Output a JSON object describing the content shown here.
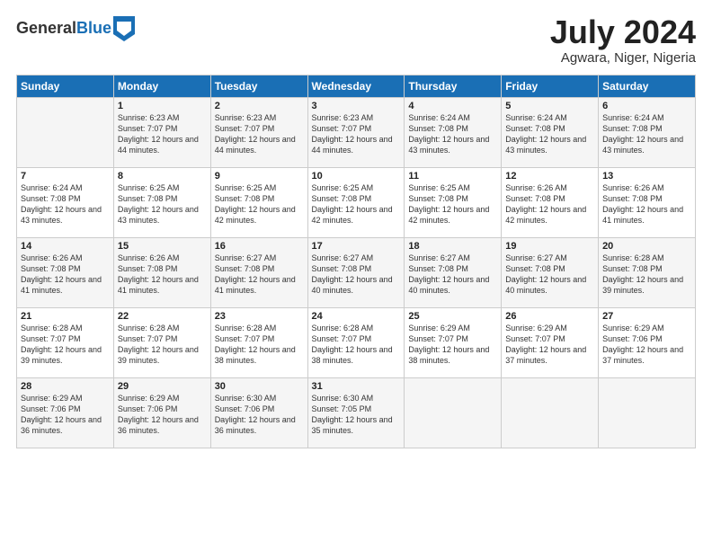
{
  "logo": {
    "general": "General",
    "blue": "Blue"
  },
  "header": {
    "month": "July 2024",
    "location": "Agwara, Niger, Nigeria"
  },
  "weekdays": [
    "Sunday",
    "Monday",
    "Tuesday",
    "Wednesday",
    "Thursday",
    "Friday",
    "Saturday"
  ],
  "weeks": [
    [
      {
        "day": "",
        "sunrise": "",
        "sunset": "",
        "daylight": ""
      },
      {
        "day": "1",
        "sunrise": "Sunrise: 6:23 AM",
        "sunset": "Sunset: 7:07 PM",
        "daylight": "Daylight: 12 hours and 44 minutes."
      },
      {
        "day": "2",
        "sunrise": "Sunrise: 6:23 AM",
        "sunset": "Sunset: 7:07 PM",
        "daylight": "Daylight: 12 hours and 44 minutes."
      },
      {
        "day": "3",
        "sunrise": "Sunrise: 6:23 AM",
        "sunset": "Sunset: 7:07 PM",
        "daylight": "Daylight: 12 hours and 44 minutes."
      },
      {
        "day": "4",
        "sunrise": "Sunrise: 6:24 AM",
        "sunset": "Sunset: 7:08 PM",
        "daylight": "Daylight: 12 hours and 43 minutes."
      },
      {
        "day": "5",
        "sunrise": "Sunrise: 6:24 AM",
        "sunset": "Sunset: 7:08 PM",
        "daylight": "Daylight: 12 hours and 43 minutes."
      },
      {
        "day": "6",
        "sunrise": "Sunrise: 6:24 AM",
        "sunset": "Sunset: 7:08 PM",
        "daylight": "Daylight: 12 hours and 43 minutes."
      }
    ],
    [
      {
        "day": "7",
        "sunrise": "Sunrise: 6:24 AM",
        "sunset": "Sunset: 7:08 PM",
        "daylight": "Daylight: 12 hours and 43 minutes."
      },
      {
        "day": "8",
        "sunrise": "Sunrise: 6:25 AM",
        "sunset": "Sunset: 7:08 PM",
        "daylight": "Daylight: 12 hours and 43 minutes."
      },
      {
        "day": "9",
        "sunrise": "Sunrise: 6:25 AM",
        "sunset": "Sunset: 7:08 PM",
        "daylight": "Daylight: 12 hours and 42 minutes."
      },
      {
        "day": "10",
        "sunrise": "Sunrise: 6:25 AM",
        "sunset": "Sunset: 7:08 PM",
        "daylight": "Daylight: 12 hours and 42 minutes."
      },
      {
        "day": "11",
        "sunrise": "Sunrise: 6:25 AM",
        "sunset": "Sunset: 7:08 PM",
        "daylight": "Daylight: 12 hours and 42 minutes."
      },
      {
        "day": "12",
        "sunrise": "Sunrise: 6:26 AM",
        "sunset": "Sunset: 7:08 PM",
        "daylight": "Daylight: 12 hours and 42 minutes."
      },
      {
        "day": "13",
        "sunrise": "Sunrise: 6:26 AM",
        "sunset": "Sunset: 7:08 PM",
        "daylight": "Daylight: 12 hours and 41 minutes."
      }
    ],
    [
      {
        "day": "14",
        "sunrise": "Sunrise: 6:26 AM",
        "sunset": "Sunset: 7:08 PM",
        "daylight": "Daylight: 12 hours and 41 minutes."
      },
      {
        "day": "15",
        "sunrise": "Sunrise: 6:26 AM",
        "sunset": "Sunset: 7:08 PM",
        "daylight": "Daylight: 12 hours and 41 minutes."
      },
      {
        "day": "16",
        "sunrise": "Sunrise: 6:27 AM",
        "sunset": "Sunset: 7:08 PM",
        "daylight": "Daylight: 12 hours and 41 minutes."
      },
      {
        "day": "17",
        "sunrise": "Sunrise: 6:27 AM",
        "sunset": "Sunset: 7:08 PM",
        "daylight": "Daylight: 12 hours and 40 minutes."
      },
      {
        "day": "18",
        "sunrise": "Sunrise: 6:27 AM",
        "sunset": "Sunset: 7:08 PM",
        "daylight": "Daylight: 12 hours and 40 minutes."
      },
      {
        "day": "19",
        "sunrise": "Sunrise: 6:27 AM",
        "sunset": "Sunset: 7:08 PM",
        "daylight": "Daylight: 12 hours and 40 minutes."
      },
      {
        "day": "20",
        "sunrise": "Sunrise: 6:28 AM",
        "sunset": "Sunset: 7:08 PM",
        "daylight": "Daylight: 12 hours and 39 minutes."
      }
    ],
    [
      {
        "day": "21",
        "sunrise": "Sunrise: 6:28 AM",
        "sunset": "Sunset: 7:07 PM",
        "daylight": "Daylight: 12 hours and 39 minutes."
      },
      {
        "day": "22",
        "sunrise": "Sunrise: 6:28 AM",
        "sunset": "Sunset: 7:07 PM",
        "daylight": "Daylight: 12 hours and 39 minutes."
      },
      {
        "day": "23",
        "sunrise": "Sunrise: 6:28 AM",
        "sunset": "Sunset: 7:07 PM",
        "daylight": "Daylight: 12 hours and 38 minutes."
      },
      {
        "day": "24",
        "sunrise": "Sunrise: 6:28 AM",
        "sunset": "Sunset: 7:07 PM",
        "daylight": "Daylight: 12 hours and 38 minutes."
      },
      {
        "day": "25",
        "sunrise": "Sunrise: 6:29 AM",
        "sunset": "Sunset: 7:07 PM",
        "daylight": "Daylight: 12 hours and 38 minutes."
      },
      {
        "day": "26",
        "sunrise": "Sunrise: 6:29 AM",
        "sunset": "Sunset: 7:07 PM",
        "daylight": "Daylight: 12 hours and 37 minutes."
      },
      {
        "day": "27",
        "sunrise": "Sunrise: 6:29 AM",
        "sunset": "Sunset: 7:06 PM",
        "daylight": "Daylight: 12 hours and 37 minutes."
      }
    ],
    [
      {
        "day": "28",
        "sunrise": "Sunrise: 6:29 AM",
        "sunset": "Sunset: 7:06 PM",
        "daylight": "Daylight: 12 hours and 36 minutes."
      },
      {
        "day": "29",
        "sunrise": "Sunrise: 6:29 AM",
        "sunset": "Sunset: 7:06 PM",
        "daylight": "Daylight: 12 hours and 36 minutes."
      },
      {
        "day": "30",
        "sunrise": "Sunrise: 6:30 AM",
        "sunset": "Sunset: 7:06 PM",
        "daylight": "Daylight: 12 hours and 36 minutes."
      },
      {
        "day": "31",
        "sunrise": "Sunrise: 6:30 AM",
        "sunset": "Sunset: 7:05 PM",
        "daylight": "Daylight: 12 hours and 35 minutes."
      },
      {
        "day": "",
        "sunrise": "",
        "sunset": "",
        "daylight": ""
      },
      {
        "day": "",
        "sunrise": "",
        "sunset": "",
        "daylight": ""
      },
      {
        "day": "",
        "sunrise": "",
        "sunset": "",
        "daylight": ""
      }
    ]
  ]
}
